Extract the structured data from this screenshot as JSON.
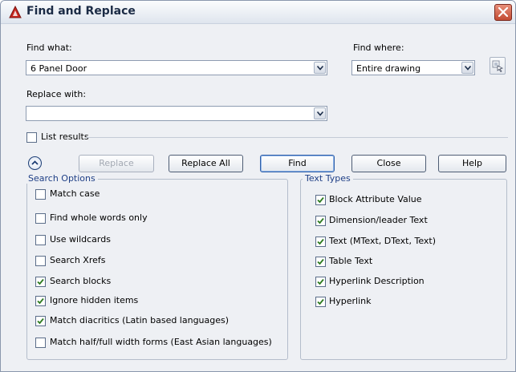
{
  "window": {
    "title": "Find and Replace"
  },
  "find": {
    "label": "Find what:",
    "value": "6 Panel Door"
  },
  "find_where": {
    "label": "Find where:",
    "value": "Entire drawing"
  },
  "replace": {
    "label": "Replace with:",
    "value": ""
  },
  "list_results": {
    "label": "List results",
    "checked": false
  },
  "buttons": {
    "replace": "Replace",
    "replace_all": "Replace All",
    "find": "Find",
    "close": "Close",
    "help": "Help"
  },
  "search_options": {
    "legend": "Search Options",
    "items": [
      {
        "label": "Match case",
        "checked": false
      },
      {
        "label": "Find whole words only",
        "checked": false
      },
      {
        "label": "Use wildcards",
        "checked": false
      },
      {
        "label": "Search Xrefs",
        "checked": false
      },
      {
        "label": "Search blocks",
        "checked": true
      },
      {
        "label": "Ignore hidden items",
        "checked": true
      },
      {
        "label": "Match diacritics (Latin based languages)",
        "checked": true
      },
      {
        "label": "Match half/full width forms (East Asian languages)",
        "checked": false
      }
    ]
  },
  "text_types": {
    "legend": "Text Types",
    "items": [
      {
        "label": "Block Attribute Value",
        "checked": true
      },
      {
        "label": "Dimension/leader Text",
        "checked": true
      },
      {
        "label": "Text (MText, DText, Text)",
        "checked": true
      },
      {
        "label": "Table Text",
        "checked": true
      },
      {
        "label": "Hyperlink Description",
        "checked": true
      },
      {
        "label": "Hyperlink",
        "checked": true
      }
    ]
  },
  "colors": {
    "legend": "#1f3f86",
    "check": "#2d7a1f",
    "close_button": "#c24a32"
  },
  "icons": [
    "autocad-app-icon",
    "close-icon",
    "chevron-down-icon",
    "select-objects-icon",
    "collapse-options-icon",
    "checkmark-icon"
  ]
}
